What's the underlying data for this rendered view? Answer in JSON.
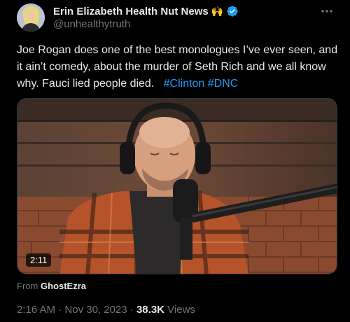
{
  "author": {
    "name": "Erin Elizabeth Health Nut News",
    "emoji": "🙌",
    "handle": "@unhealthytruth",
    "verified_icon": "verified-badge-icon",
    "verified_color": "#1d9bf0"
  },
  "tweet": {
    "text": "Joe Rogan does one of the best monologues I’ve ever seen, and it ain’t comedy, about the murder of Seth Rich and we all know why. Fauci lied people died.",
    "hashtags": [
      "#Clinton",
      "#DNC"
    ]
  },
  "media": {
    "duration": "2:11"
  },
  "attribution": {
    "prefix": "From",
    "source": "GhostEzra"
  },
  "meta": {
    "time": "2:16 AM",
    "separator": "·",
    "date": "Nov 30, 2023",
    "views_count": "38.3K",
    "views_label": "Views"
  },
  "colors": {
    "background": "#000000",
    "text": "#e7e9ea",
    "secondary": "#71767b",
    "accent": "#1d9bf0"
  }
}
